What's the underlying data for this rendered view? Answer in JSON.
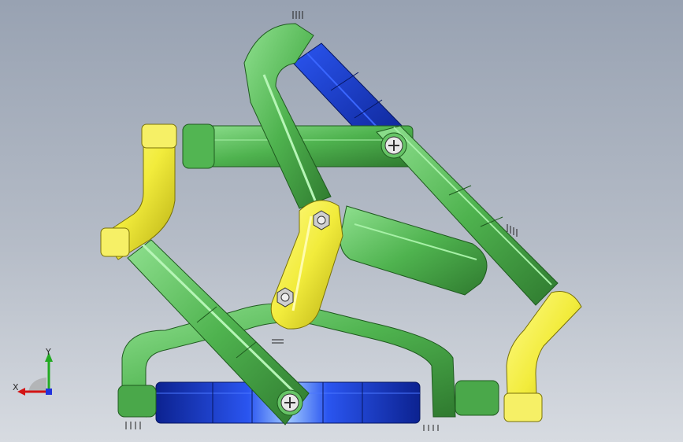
{
  "viewport": {
    "triad": {
      "x_label": "X",
      "y_label": "Y"
    }
  },
  "colors": {
    "green": "#4aa84a",
    "green_light": "#8fe08f",
    "green_dark": "#2f7a2f",
    "yellow": "#f2ec3c",
    "yellow_dark": "#b7ae12",
    "blue": "#1c3fe0",
    "blue_dark": "#0c2290",
    "axis_x": "#d31414",
    "axis_y": "#22aa22",
    "axis_z": "#2233dd"
  },
  "icons": [
    "screw-icon",
    "nut-icon",
    "axis-triad-icon"
  ]
}
